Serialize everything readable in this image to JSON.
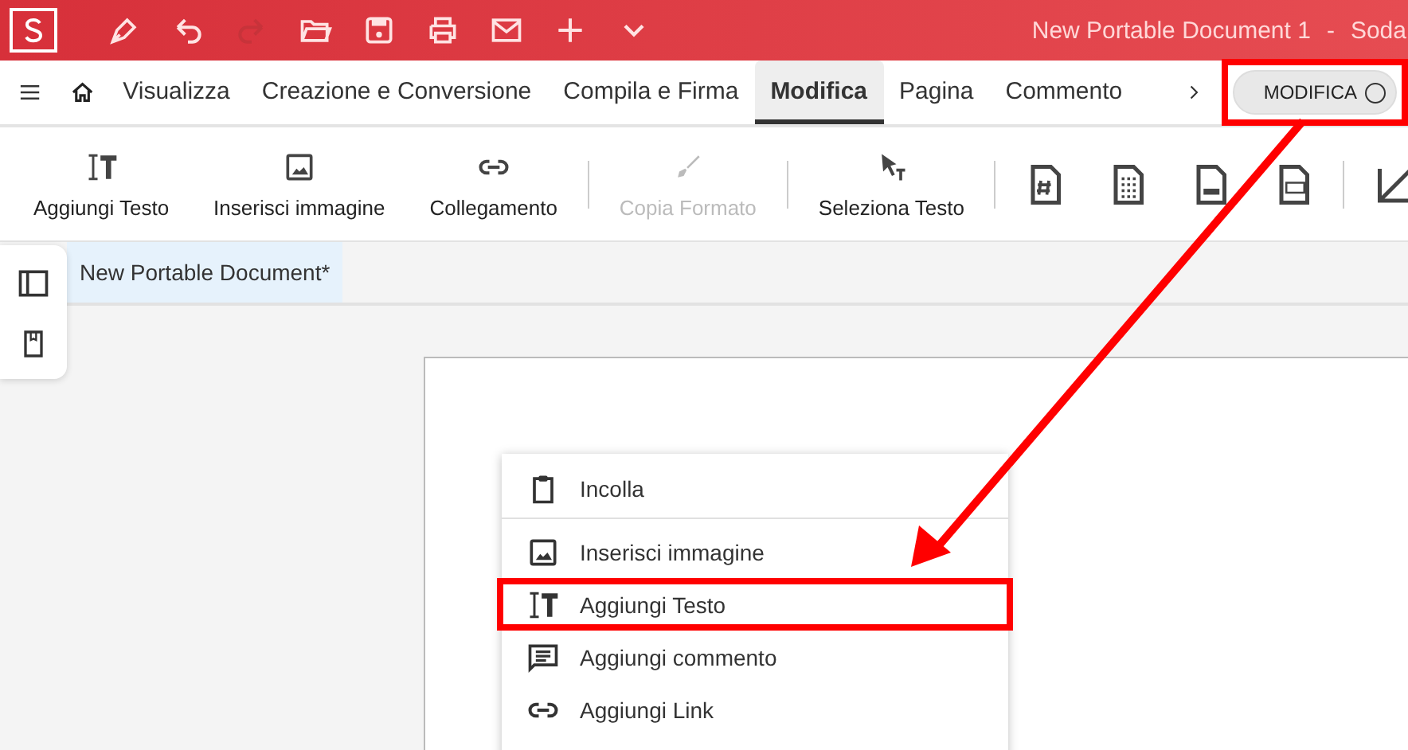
{
  "title_bar": {
    "quick_tools": [
      {
        "kind": "pen"
      },
      {
        "kind": "undo",
        "disabled": false
      },
      {
        "kind": "redo",
        "disabled": true
      },
      {
        "kind": "open"
      },
      {
        "kind": "save"
      },
      {
        "kind": "print"
      },
      {
        "kind": "mail"
      },
      {
        "kind": "plus"
      },
      {
        "kind": "chevron"
      }
    ],
    "document_title": "New Portable Document 1",
    "separator": "-",
    "app_name": "Soda"
  },
  "menu_tabs": [
    {
      "label": "Visualizza",
      "selected": false
    },
    {
      "label": "Creazione e Conversione",
      "selected": false
    },
    {
      "label": "Compila e Firma",
      "selected": false
    },
    {
      "label": "Modifica",
      "selected": true
    },
    {
      "label": "Pagina",
      "selected": false
    },
    {
      "label": "Commento",
      "selected": false
    }
  ],
  "mode_toggle": {
    "label": "MODIFICA",
    "on": false,
    "callout": true
  },
  "toolbar": [
    {
      "kind": "add-text",
      "label": "Aggiungi Testo",
      "disabled": false
    },
    {
      "kind": "image",
      "label": "Inserisci immagine",
      "disabled": false
    },
    {
      "kind": "link",
      "label": "Collegamento",
      "disabled": false
    },
    {
      "kind": "separator"
    },
    {
      "kind": "brush",
      "label": "Copia Formato",
      "disabled": true
    },
    {
      "kind": "separator"
    },
    {
      "kind": "select-text",
      "label": "Seleziona Testo",
      "disabled": false
    },
    {
      "kind": "separator"
    },
    {
      "kind": "file-hash",
      "disabled": false
    },
    {
      "kind": "file-dots",
      "disabled": false
    },
    {
      "kind": "file-bar",
      "disabled": false
    },
    {
      "kind": "file-binary",
      "disabled": false
    },
    {
      "kind": "separator"
    },
    {
      "kind": "crop",
      "disabled": false
    }
  ],
  "document_tab": {
    "label": "New Portable Document*",
    "selected": true
  },
  "context_menu": [
    {
      "kind": "paste",
      "label": "Incolla",
      "callout": false
    },
    {
      "kind": "divider"
    },
    {
      "kind": "image",
      "label": "Inserisci immagine",
      "callout": false
    },
    {
      "kind": "add-text",
      "label": "Aggiungi Testo",
      "callout": true
    },
    {
      "kind": "comment",
      "label": "Aggiungi commento",
      "callout": false
    },
    {
      "kind": "link",
      "label": "Aggiungi Link",
      "callout": false
    }
  ]
}
